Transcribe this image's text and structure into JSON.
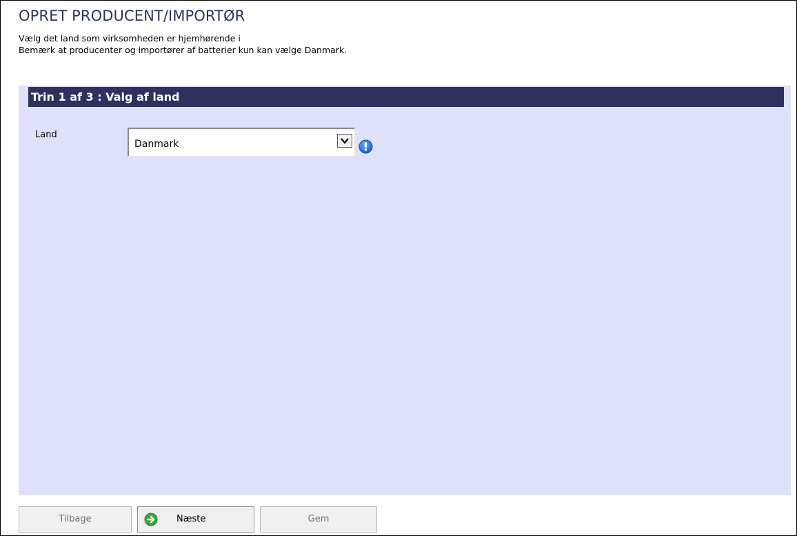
{
  "page": {
    "title": "OPRET PRODUCENT/IMPORTØR",
    "intro_line1": "Vælg det land som virksomheden er hjemhørende i",
    "intro_line2": "Bemærk at producenter og importører af batterier kun kan vælge Danmark."
  },
  "step": {
    "header": "Trin 1 af 3 : Valg af land"
  },
  "form": {
    "country_label": "Land",
    "country_value": "Danmark",
    "info_icon": "info-icon"
  },
  "buttons": {
    "back": "Tilbage",
    "next": "Næste",
    "save": "Gem",
    "next_icon": "arrow-right-circle-icon"
  },
  "colors": {
    "title": "#2d3560",
    "panel_bg": "#dfe0fb",
    "header_bg": "#2f305e",
    "info_icon": "#1f6fd6",
    "next_icon": "#3aa33a"
  }
}
